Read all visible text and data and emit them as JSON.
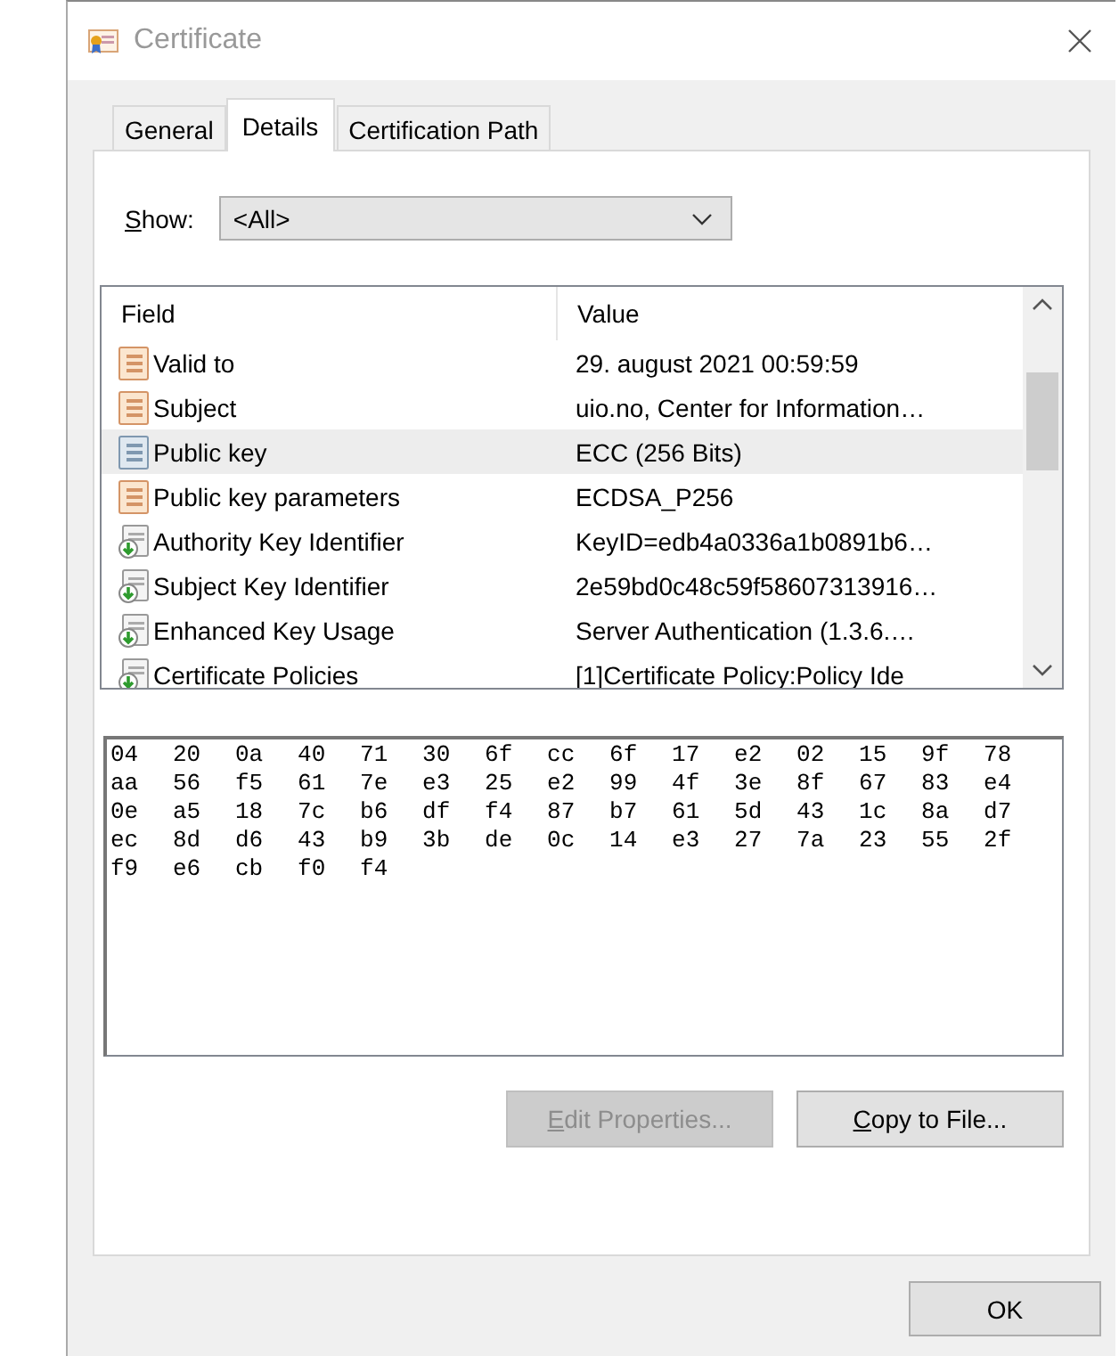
{
  "window": {
    "title": "Certificate"
  },
  "tabs": [
    {
      "label": "General",
      "selected": false
    },
    {
      "label": "Details",
      "selected": true
    },
    {
      "label": "Certification Path",
      "selected": false
    }
  ],
  "show": {
    "label_key": "S",
    "label_rest": "how:",
    "value": "<All>"
  },
  "fields_table": {
    "columns": [
      "Field",
      "Value"
    ],
    "rows": [
      {
        "kind": "property",
        "field": "Valid to",
        "value": "29. august 2021 00:59:59",
        "selected": false
      },
      {
        "kind": "property",
        "field": "Subject",
        "value": "uio.no, Center for Information…",
        "selected": false
      },
      {
        "kind": "property",
        "field": "Public key",
        "value": "ECC (256 Bits)",
        "selected": true
      },
      {
        "kind": "property",
        "field": "Public key parameters",
        "value": "ECDSA_P256",
        "selected": false
      },
      {
        "kind": "extension",
        "field": "Authority Key Identifier",
        "value": "KeyID=edb4a0336a1b0891b6…",
        "selected": false
      },
      {
        "kind": "extension",
        "field": "Subject Key Identifier",
        "value": "2e59bd0c48c59f58607313916…",
        "selected": false
      },
      {
        "kind": "extension",
        "field": "Enhanced Key Usage",
        "value": "Server Authentication (1.3.6.…",
        "selected": false
      },
      {
        "kind": "extension",
        "field": "Certificate Policies",
        "value": "[1]Certificate Policy:Policy Ide",
        "selected": false
      }
    ]
  },
  "value_box": {
    "lines": [
      "04 20 0a 40 71 30 6f cc 6f 17 e2 02 15 9f 78",
      "aa 56 f5 61 7e e3 25 e2 99 4f 3e 8f 67 83 e4",
      "0e a5 18 7c b6 df f4 87 b7 61 5d 43 1c 8a d7",
      "ec 8d d6 43 b9 3b de 0c 14 e3 27 7a 23 55 2f",
      "f9 e6 cb f0 f4"
    ]
  },
  "buttons": [
    {
      "label_key": "E",
      "label_rest": "dit Properties...",
      "disabled": true
    },
    {
      "label_key": "C",
      "label_rest": "opy to File...",
      "disabled": false
    }
  ],
  "dialog_buttons": [
    {
      "label": "OK"
    }
  ]
}
